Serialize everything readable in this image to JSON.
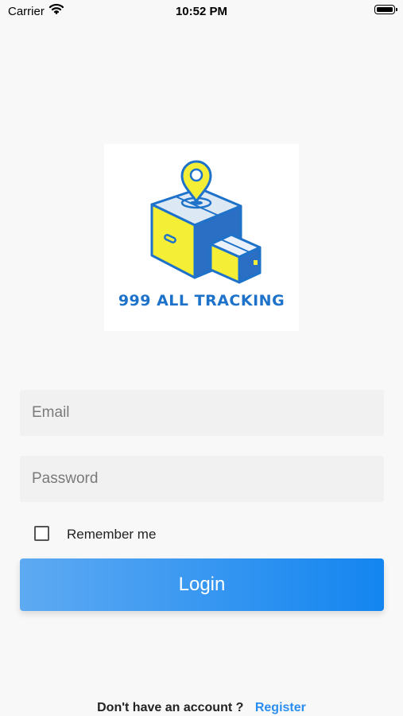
{
  "status_bar": {
    "carrier": "Carrier",
    "time": "10:52 PM"
  },
  "logo": {
    "text": "999 ALL TRACKING"
  },
  "form": {
    "email_placeholder": "Email",
    "password_placeholder": "Password",
    "remember_label": "Remember me",
    "remember_checked": false,
    "login_label": "Login"
  },
  "footer": {
    "question": "Don't have an account ?",
    "register_label": "Register"
  },
  "colors": {
    "brand_blue": "#1e72c9",
    "box_yellow": "#f5ee37",
    "button_gradient_start": "#5eaaf2",
    "button_gradient_end": "#1385f0",
    "link_blue": "#2a8ef0"
  }
}
